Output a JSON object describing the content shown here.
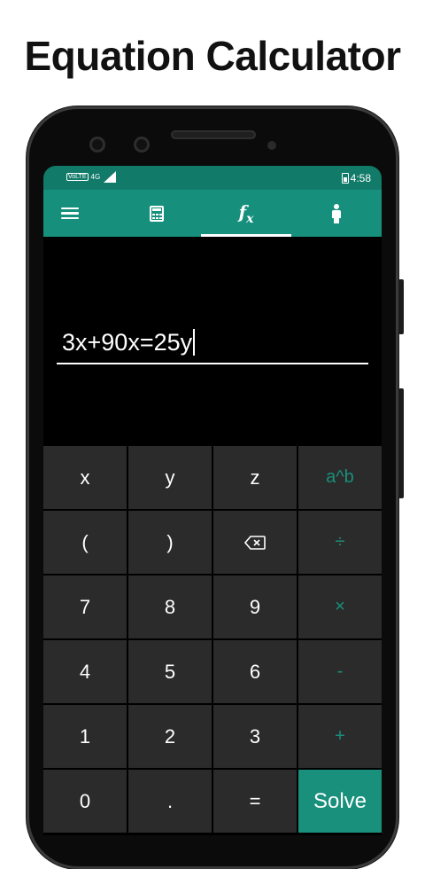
{
  "headline": "Equation Calculator",
  "status_bar": {
    "volte": "VoLTE",
    "network": "4G",
    "time": "4:58",
    "icons": [
      "volte-icon",
      "signal-icon",
      "battery-icon"
    ]
  },
  "tabs": [
    {
      "name": "menu",
      "icon": "menu-icon"
    },
    {
      "name": "calculator",
      "icon": "calculator-icon"
    },
    {
      "name": "equation",
      "icon": "fx-icon",
      "label": "f",
      "sub": "x",
      "selected": true
    },
    {
      "name": "profile",
      "icon": "person-icon"
    }
  ],
  "display": {
    "expression": "3x+90x=25y"
  },
  "keypad": {
    "rows": [
      [
        "x",
        "y",
        "z",
        "a^b"
      ],
      [
        "(",
        ")",
        "⌫",
        "÷"
      ],
      [
        "7",
        "8",
        "9",
        "×"
      ],
      [
        "4",
        "5",
        "6",
        "-"
      ],
      [
        "1",
        "2",
        "3",
        "+"
      ],
      [
        "0",
        ".",
        "=",
        "Solve"
      ]
    ]
  },
  "colors": {
    "statusbar": "#127a68",
    "toolbar": "#16907c",
    "key_bg": "#2b2b2b",
    "operator_text": "#1a8f7b",
    "solve_bg": "#18907c"
  }
}
